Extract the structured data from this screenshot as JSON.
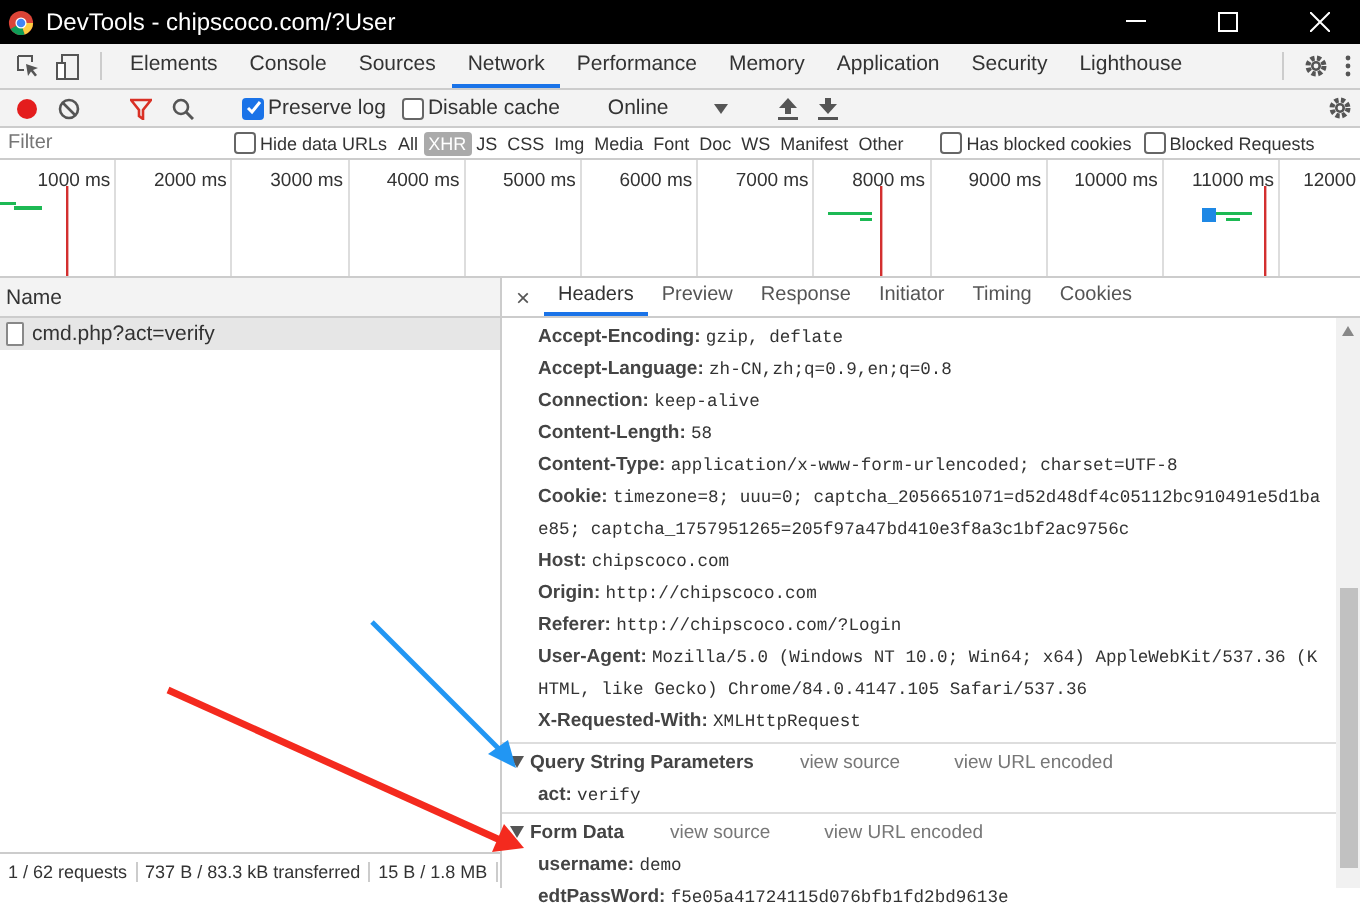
{
  "window": {
    "title": "DevTools - chipscoco.com/?User"
  },
  "tabs": [
    {
      "label": "Elements",
      "selected": false
    },
    {
      "label": "Console",
      "selected": false
    },
    {
      "label": "Sources",
      "selected": false
    },
    {
      "label": "Network",
      "selected": true
    },
    {
      "label": "Performance",
      "selected": false
    },
    {
      "label": "Memory",
      "selected": false
    },
    {
      "label": "Application",
      "selected": false
    },
    {
      "label": "Security",
      "selected": false
    },
    {
      "label": "Lighthouse",
      "selected": false
    }
  ],
  "toolbar": {
    "recording": true,
    "preserve_log": {
      "label": "Preserve log",
      "checked": true
    },
    "disable_cache": {
      "label": "Disable cache",
      "checked": false
    },
    "throttling": "Online"
  },
  "filter_bar": {
    "placeholder": "Filter",
    "hide_data_urls": {
      "label": "Hide data URLs",
      "checked": false
    },
    "types": [
      {
        "label": "All",
        "selected": false
      },
      {
        "label": "XHR",
        "selected": true
      },
      {
        "label": "JS",
        "selected": false
      },
      {
        "label": "CSS",
        "selected": false
      },
      {
        "label": "Img",
        "selected": false
      },
      {
        "label": "Media",
        "selected": false
      },
      {
        "label": "Font",
        "selected": false
      },
      {
        "label": "Doc",
        "selected": false
      },
      {
        "label": "WS",
        "selected": false
      },
      {
        "label": "Manifest",
        "selected": false
      },
      {
        "label": "Other",
        "selected": false
      }
    ],
    "has_blocked_cookies": {
      "label": "Has blocked cookies",
      "checked": false
    },
    "blocked_requests": {
      "label": "Blocked Requests",
      "checked": false
    }
  },
  "timeline": {
    "ticks": [
      "1000 ms",
      "2000 ms",
      "3000 ms",
      "4000 ms",
      "5000 ms",
      "6000 ms",
      "7000 ms",
      "8000 ms",
      "9000 ms",
      "10000 ms",
      "11000 ms",
      "12000"
    ]
  },
  "requests": {
    "column": "Name",
    "rows": [
      {
        "name": "cmd.php?act=verify",
        "selected": true
      }
    ]
  },
  "status_bar": [
    "1 / 62 requests",
    "737 B / 83.3 kB transferred",
    "15 B / 1.8 MB"
  ],
  "detail": {
    "close": "×",
    "tabs": [
      {
        "label": "Headers",
        "selected": true
      },
      {
        "label": "Preview",
        "selected": false
      },
      {
        "label": "Response",
        "selected": false
      },
      {
        "label": "Initiator",
        "selected": false
      },
      {
        "label": "Timing",
        "selected": false
      },
      {
        "label": "Cookies",
        "selected": false
      }
    ],
    "headers": [
      {
        "name": "Accept-Encoding:",
        "value": "gzip, deflate"
      },
      {
        "name": "Accept-Language:",
        "value": "zh-CN,zh;q=0.9,en;q=0.8"
      },
      {
        "name": "Connection:",
        "value": "keep-alive"
      },
      {
        "name": "Content-Length:",
        "value": "58"
      },
      {
        "name": "Content-Type:",
        "value": "application/x-www-form-urlencoded; charset=UTF-8"
      },
      {
        "name": "Cookie:",
        "value": "timezone=8; uuu=0; captcha_2056651071=d52d48df4c05112bc910491e5d1bae85; captcha_1757951265=205f97a47bd410e3f8a3c1bf2ac9756c"
      },
      {
        "name": "Host:",
        "value": "chipscoco.com"
      },
      {
        "name": "Origin:",
        "value": "http://chipscoco.com"
      },
      {
        "name": "Referer:",
        "value": "http://chipscoco.com/?Login"
      },
      {
        "name": "User-Agent:",
        "value": "Mozilla/5.0 (Windows NT 10.0; Win64; x64) AppleWebKit/537.36 (KHTML, like Gecko) Chrome/84.0.4147.105 Safari/537.36"
      },
      {
        "name": "X-Requested-With:",
        "value": "XMLHttpRequest"
      }
    ],
    "sections": [
      {
        "title": "Query String Parameters",
        "expanded": true,
        "links": [
          "view source",
          "view URL encoded"
        ],
        "params": [
          {
            "name": "act:",
            "value": "verify"
          }
        ]
      },
      {
        "title": "Form Data",
        "expanded": true,
        "links": [
          "view source",
          "view URL encoded"
        ],
        "params": [
          {
            "name": "username:",
            "value": "demo"
          },
          {
            "name": "edtPassWord:",
            "value": "f5e05a41724115d076bfb1fd2bd9613e"
          }
        ]
      }
    ]
  }
}
